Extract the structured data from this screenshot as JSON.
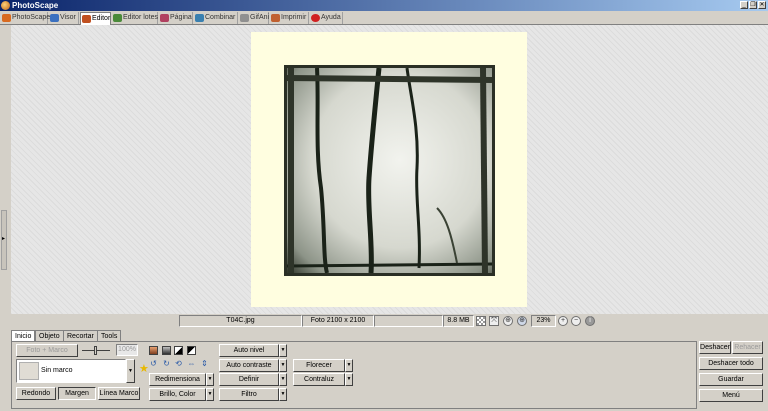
{
  "window": {
    "title": "PhotoScape",
    "controls": {
      "minimize": "_",
      "restore": "❐",
      "close": "✕"
    }
  },
  "tabs": [
    {
      "label": "PhotoScape",
      "icon": "photoscape-icon",
      "color": "#d86a20"
    },
    {
      "label": "Visor",
      "icon": "viewer-icon",
      "color": "#3a70c0"
    },
    {
      "label": "Editor",
      "icon": "editor-icon",
      "color": "#c05020",
      "active": true
    },
    {
      "label": "Editor lotes",
      "icon": "batch-editor-icon",
      "color": "#4a8a3a"
    },
    {
      "label": "Página",
      "icon": "page-icon",
      "color": "#b04060"
    },
    {
      "label": "Combinar",
      "icon": "combine-icon",
      "color": "#3a80b0"
    },
    {
      "label": "GifAni",
      "icon": "gifani-icon",
      "color": "#909090"
    },
    {
      "label": "Imprimir",
      "icon": "print-icon",
      "color": "#c06030"
    },
    {
      "label": "Ayuda",
      "icon": "help-icon",
      "color": "#d02020"
    }
  ],
  "canvas": {
    "background_color": "#fffee0"
  },
  "status": {
    "filename": "T04C.jpg",
    "dimensions": "Foto 2100 x 2100",
    "blank": "",
    "filesize": "8.8 MB",
    "zoom": "23%",
    "icons": [
      "checker-icon",
      "fit-icon",
      "zoom-fit-icon",
      "zoom-icon",
      "zoom-in-icon",
      "zoom-out-icon",
      "info-icon"
    ]
  },
  "bottom_tabs": [
    {
      "label": "Inicio",
      "active": true
    },
    {
      "label": "Objeto"
    },
    {
      "label": "Recortar"
    },
    {
      "label": "Tools"
    }
  ],
  "home": {
    "photo_frame": "Foto + Marco",
    "frame_percent": "100%",
    "frame_name": "Sin marco",
    "rounded": "Redondo",
    "margin": "Margen",
    "frame_line": "Línea Marco",
    "resize": "Redimensiona",
    "brightness": "Brillo, Color",
    "auto_level": "Auto nivel",
    "auto_contrast": "Auto contraste",
    "sharpen": "Definir",
    "filter": "Filtro",
    "bloom": "Florecer",
    "backlight": "Contraluz"
  },
  "right": {
    "undo": "Deshacer",
    "redo": "Rehacer",
    "undo_all": "Deshacer todo",
    "save": "Guardar",
    "menu": "Menú"
  },
  "colors": {
    "accent_title": "#0a246a",
    "star": "#e8b800"
  }
}
